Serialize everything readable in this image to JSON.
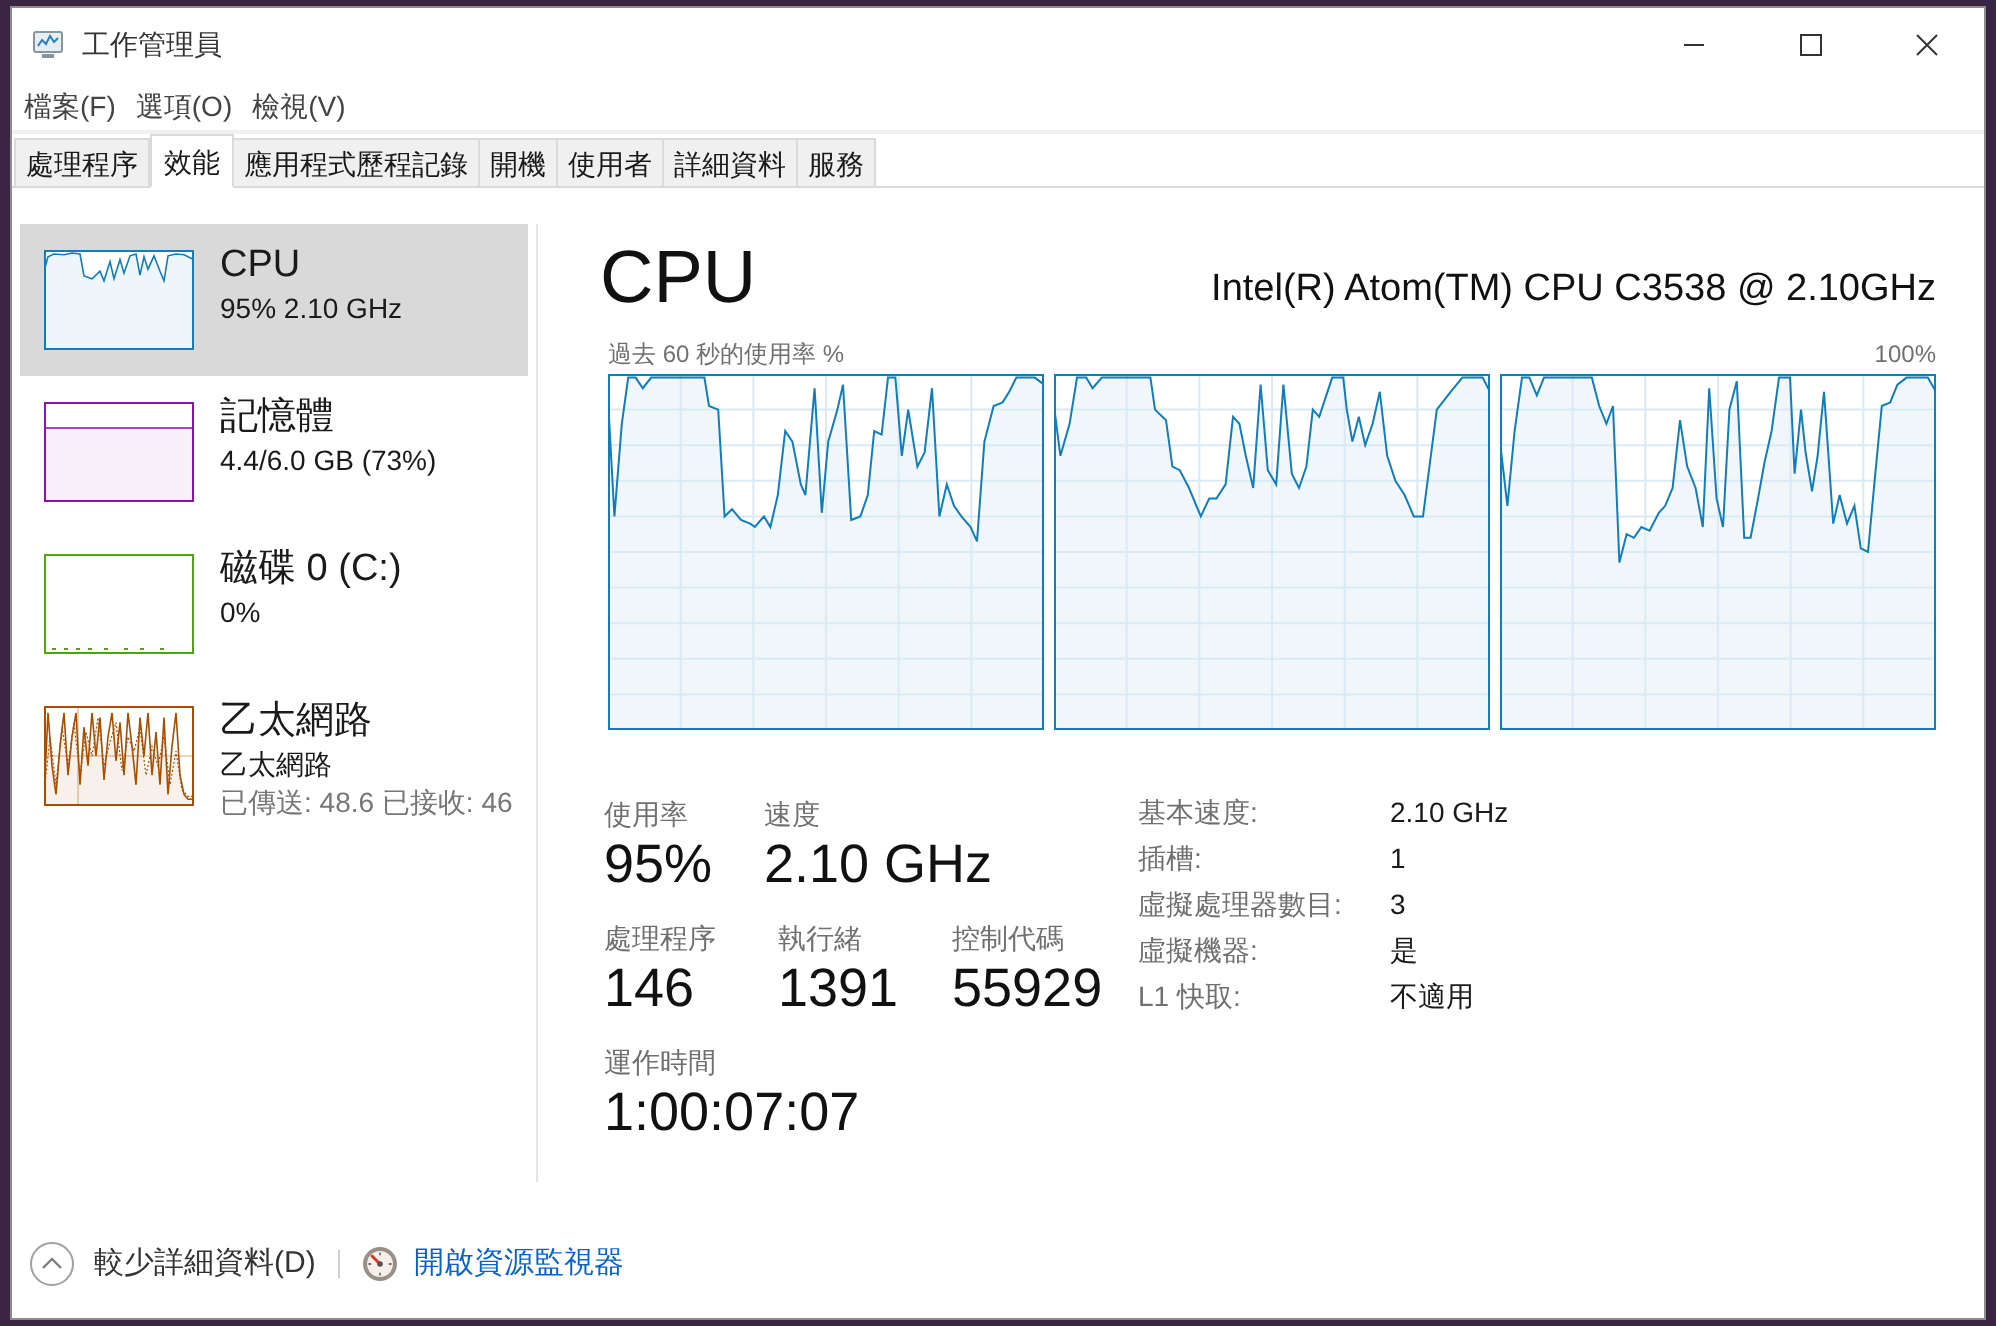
{
  "window": {
    "title": "工作管理員"
  },
  "menu": [
    "檔案(F)",
    "選項(O)",
    "檢視(V)"
  ],
  "tabs": [
    {
      "label": "處理程序",
      "selected": false
    },
    {
      "label": "效能",
      "selected": true
    },
    {
      "label": "應用程式歷程記錄",
      "selected": false
    },
    {
      "label": "開機",
      "selected": false
    },
    {
      "label": "使用者",
      "selected": false
    },
    {
      "label": "詳細資料",
      "selected": false
    },
    {
      "label": "服務",
      "selected": false
    }
  ],
  "sidebar": {
    "items": [
      {
        "kind": "cpu",
        "color": "#117dbb",
        "title": "CPU",
        "subtitle": "95% 2.10 GHz",
        "selected": true
      },
      {
        "kind": "memory",
        "color": "#8b12ae",
        "title": "記憶體",
        "subtitle": "4.4/6.0 GB (73%)",
        "selected": false
      },
      {
        "kind": "disk",
        "color": "#4da60c",
        "title": "磁碟 0 (C:)",
        "subtitle": "0%",
        "selected": false
      },
      {
        "kind": "network",
        "color": "#a74f01",
        "title": "乙太網路",
        "subtitle": "乙太網路",
        "traffic": "已傳送: 48.6 已接收: 46",
        "selected": false
      }
    ]
  },
  "performance": {
    "title": "CPU",
    "model": "Intel(R) Atom(TM) CPU C3538 @ 2.10GHz",
    "graph_caption": "過去 60 秒的使用率 %",
    "graph_max": "100%",
    "stat_rows": [
      {
        "stats": [
          {
            "label": "使用率",
            "value": "95%"
          },
          {
            "label": "速度",
            "value": "2.10 GHz"
          }
        ]
      },
      {
        "stats": [
          {
            "label": "處理程序",
            "value": "146"
          },
          {
            "label": "執行緒",
            "value": "1391"
          },
          {
            "label": "控制代碼",
            "value": "55929"
          }
        ]
      },
      {
        "stats": [
          {
            "label": "運作時間",
            "value": "1:00:07:07"
          }
        ]
      }
    ],
    "details": [
      {
        "label": "基本速度:",
        "value": "2.10 GHz"
      },
      {
        "label": "插槽:",
        "value": "1"
      },
      {
        "label": "虛擬處理器數目:",
        "value": "3"
      },
      {
        "label": "虛擬機器:",
        "value": "是"
      },
      {
        "label": "L1 快取:",
        "value": "不適用"
      }
    ]
  },
  "footer": {
    "fewer_details": "較少詳細資料(D)",
    "resource_monitor": "開啟資源監視器"
  }
}
